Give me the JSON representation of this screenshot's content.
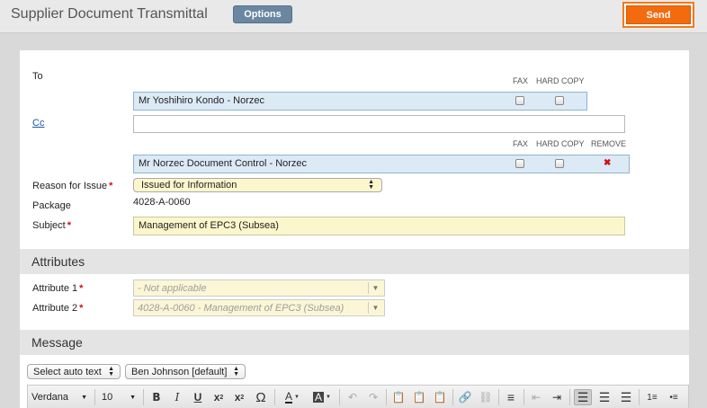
{
  "header": {
    "title": "Supplier Document Transmittal",
    "options_label": "Options",
    "send_label": "Send"
  },
  "recipients": {
    "to_label": "To",
    "cc_label": "Cc",
    "fax_label": "FAX",
    "hardcopy_label": "HARD COPY",
    "remove_label": "REMOVE",
    "to_entries": [
      {
        "name": "Mr Yoshihiro Kondo - Norzec",
        "fax": false,
        "hard_copy": false
      }
    ],
    "cc_entries": [
      {
        "name": "Mr Norzec Document Control - Norzec",
        "fax": false,
        "hard_copy": false
      }
    ],
    "cc_input_value": ""
  },
  "form": {
    "reason_label": "Reason for Issue",
    "reason_value": "Issued for Information",
    "package_label": "Package",
    "package_value": "4028-A-0060",
    "subject_label": "Subject",
    "subject_value": "Management of EPC3 (Subsea)"
  },
  "attributes": {
    "section_title": "Attributes",
    "items": [
      {
        "label": "Attribute 1",
        "value": "- Not applicable"
      },
      {
        "label": "Attribute 2",
        "value": "4028-A-0060 - Management of EPC3 (Subsea)"
      }
    ]
  },
  "message": {
    "section_title": "Message",
    "auto_text_label": "Select auto text",
    "signature_label": "Ben Johnson [default]",
    "font_family": "Verdana",
    "font_size": "10"
  },
  "toolbar_icons": [
    "bold-icon",
    "italic-icon",
    "underline-icon",
    "subscript-icon",
    "superscript-icon",
    "omega-icon",
    "text-color-icon",
    "bg-color-icon",
    "undo-icon",
    "redo-icon",
    "paste-icon",
    "paste-text-icon",
    "paste-word-icon",
    "link-icon",
    "unlink-icon",
    "horizontal-rule-icon",
    "outdent-icon",
    "indent-icon",
    "align-left-icon",
    "align-center-icon",
    "align-right-icon",
    "ordered-list-icon",
    "unordered-list-icon"
  ],
  "colors": {
    "accent": "#f26b0f",
    "options_button": "#6a86a0",
    "recipient_bg": "#dceaf6",
    "input_yellow": "#fcf6cc",
    "required": "#cc1111"
  }
}
